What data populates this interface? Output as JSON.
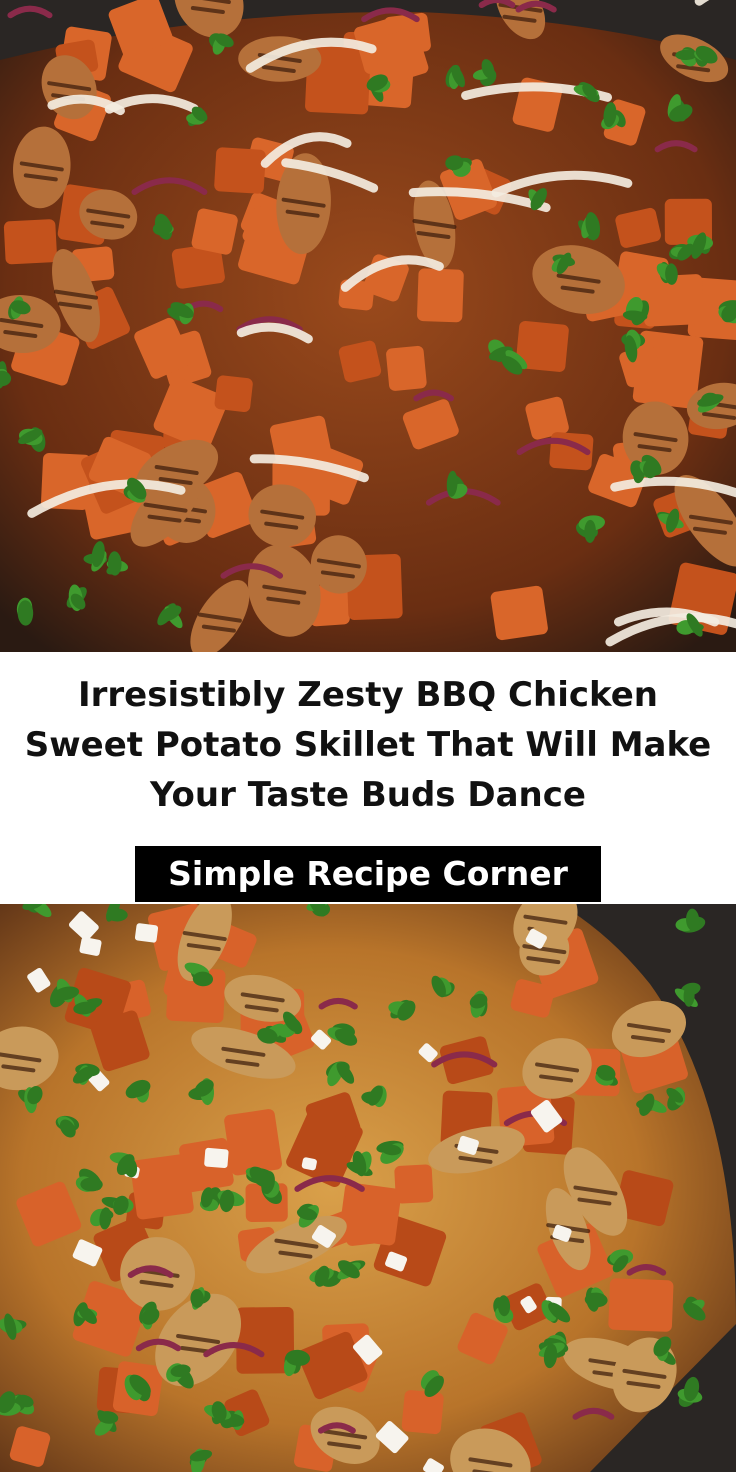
{
  "title": "Irresistibly Zesty BBQ Chicken Sweet Potato Skillet That Will Make Your Taste Buds Dance",
  "brand": "Simple Recipe Corner",
  "colors": {
    "title_text": "#111111",
    "brand_bg": "#000000",
    "brand_text": "#ffffff",
    "sweet_potato": "#d9662a",
    "chicken": "#b5703a",
    "cilantro": "#2f7a22",
    "sauce": "#f3ece0",
    "skillet": "#2a2624"
  }
}
